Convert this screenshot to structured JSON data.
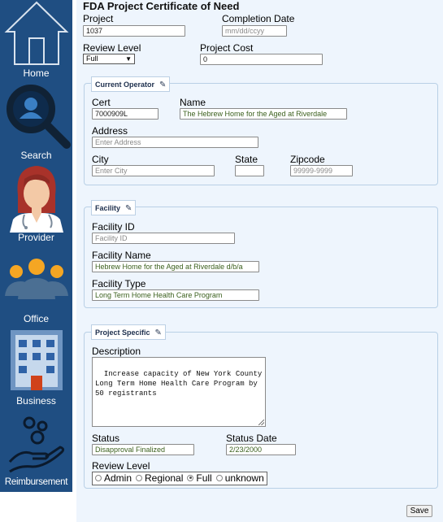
{
  "sidebar": {
    "items": [
      {
        "label": "Home",
        "icon": "home-icon"
      },
      {
        "label": "Search",
        "icon": "search-icon"
      },
      {
        "label": "Provider",
        "icon": "provider-icon"
      },
      {
        "label": "Office",
        "icon": "office-icon"
      },
      {
        "label": "Business",
        "icon": "business-icon"
      },
      {
        "label": "Reimbursement",
        "icon": "reimbursement-icon"
      }
    ],
    "bg_color": "#1f4e82"
  },
  "form": {
    "title": "FDA Project Certificate of Need",
    "project_label": "Project",
    "project_value": "1037",
    "completion_date_label": "Completion Date",
    "completion_date_placeholder": "mm/dd/ccyy",
    "review_level_label": "Review Level",
    "review_level_value": "Full",
    "project_cost_label": "Project Cost",
    "project_cost_value": "0"
  },
  "current_operator": {
    "legend": "Current Operator",
    "cert_label": "Cert",
    "cert_value": "7000909L",
    "name_label": "Name",
    "name_value": "The Hebrew Home for the Aged at Riverdale",
    "address_label": "Address",
    "address_placeholder": "Enter Address",
    "city_label": "City",
    "city_placeholder": "Enter City",
    "state_label": "State",
    "state_value": "",
    "zipcode_label": "Zipcode",
    "zipcode_placeholder": "99999-9999"
  },
  "facility": {
    "legend": "Facility",
    "facility_id_label": "Facility ID",
    "facility_id_placeholder": "Facility ID",
    "facility_name_label": "Facility Name",
    "facility_name_value": "Hebrew Home for the Aged at Riverdale d/b/a",
    "facility_type_label": "Facility Type",
    "facility_type_value": "Long Term Home Health Care Program"
  },
  "project_specific": {
    "legend": "Project Specific",
    "description_label": "Description",
    "description_value": "Increase capacity of New York County\nLong Term Home Health Care Program by\n50 registrants",
    "status_label": "Status",
    "status_value": "Disapproval Finalized",
    "status_date_label": "Status Date",
    "status_date_value": "2/23/2000",
    "review_level_label": "Review Level",
    "review_options": [
      "Admin",
      "Regional",
      "Full",
      "unknown"
    ],
    "review_selected": "Full"
  },
  "save_label": "Save"
}
